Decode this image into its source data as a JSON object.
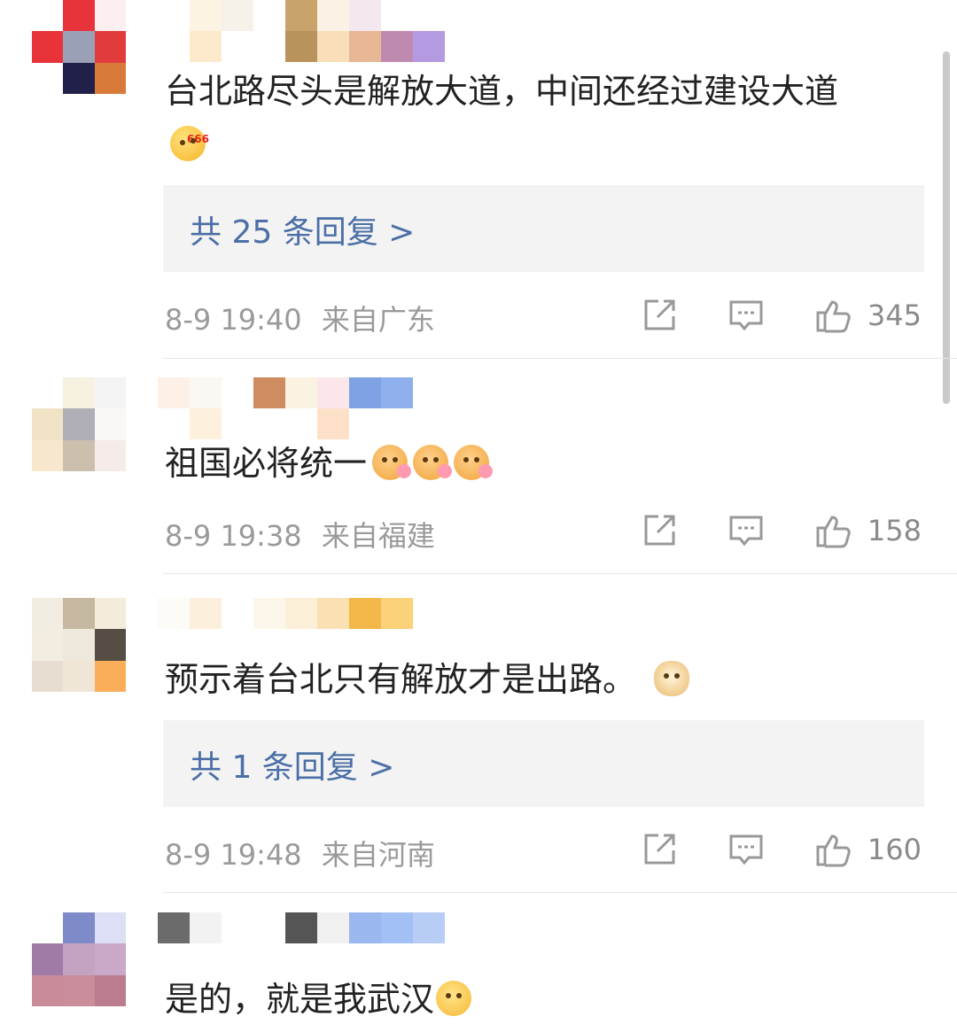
{
  "comments": [
    {
      "text": "台北路尽头是解放大道，中间还经过建设大道",
      "emoji": "666-thumbs-emoji",
      "emoji_badge": "666",
      "reply_label": "共 25 条回复 >",
      "time": "8-9 19:40",
      "location": "来自广东",
      "likes": "345"
    },
    {
      "text": "祖国必将统一",
      "emoji": "flower-face-emoji",
      "time": "8-9 19:38",
      "location": "来自福建",
      "likes": "158"
    },
    {
      "text": "预示着台北只有解放才是出路。",
      "emoji": "doge-emoji",
      "reply_label": "共 1 条回复 >",
      "time": "8-9 19:48",
      "location": "来自河南",
      "likes": "160"
    },
    {
      "text": "是的，就是我武汉",
      "emoji": "smile-emoji"
    }
  ],
  "icons": [
    "share-icon",
    "comment-icon",
    "like-icon"
  ],
  "colors": {
    "reply_link": "#4b6fa6",
    "meta_text": "#9a9a9a",
    "reply_bg": "#f3f3f3"
  }
}
